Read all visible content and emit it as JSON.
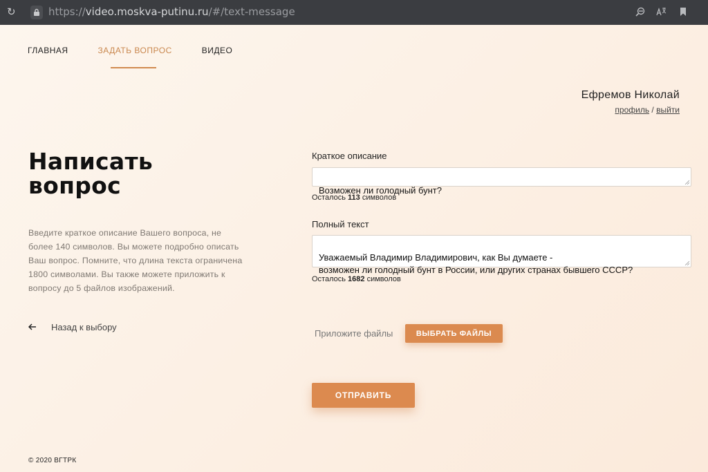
{
  "browser": {
    "url_scheme": "https://",
    "url_host": "video.moskva-putinu.ru",
    "url_path": "/#/text-message"
  },
  "nav": {
    "items": [
      {
        "label": "ГЛАВНАЯ"
      },
      {
        "label": "ЗАДАТЬ ВОПРОС"
      },
      {
        "label": "ВИДЕО"
      }
    ],
    "active_index": 1
  },
  "user": {
    "name": "Ефремов Николай",
    "profile_label": "профиль",
    "separator": " / ",
    "logout_label": "выйти"
  },
  "page": {
    "title": "Написать вопрос",
    "description": "Введите краткое описание Вашего вопроса, не более 140 символов. Вы можете подробно описать Ваш вопрос. Помните, что длина текста ограничена 1800 символами. Вы также можете приложить к вопросу до 5 файлов изображений.",
    "back_label": "Назад к выбору"
  },
  "form": {
    "short": {
      "label": "Краткое описание",
      "value": "Возможен ли голодный бунт?",
      "counter_prefix": "Осталось ",
      "counter_value": "113",
      "counter_suffix": " символов"
    },
    "full": {
      "label": "Полный текст",
      "value": "Уважаемый Владимир Владимирович, как Вы думаете -\nвозможен ли голодный бунт в России, или других странах бывшего СССР?",
      "counter_prefix": "Осталось ",
      "counter_value": "1682",
      "counter_suffix": " символов"
    },
    "attach_label": "Приложите файлы",
    "choose_files_label": "ВЫБРАТЬ ФАЙЛЫ",
    "submit_label": "ОТПРАВИТЬ"
  },
  "footer": {
    "copyright": "© 2020 ВГТРК"
  },
  "colors": {
    "accent": "#d08a4e",
    "browser_bar": "#3b3d41"
  }
}
